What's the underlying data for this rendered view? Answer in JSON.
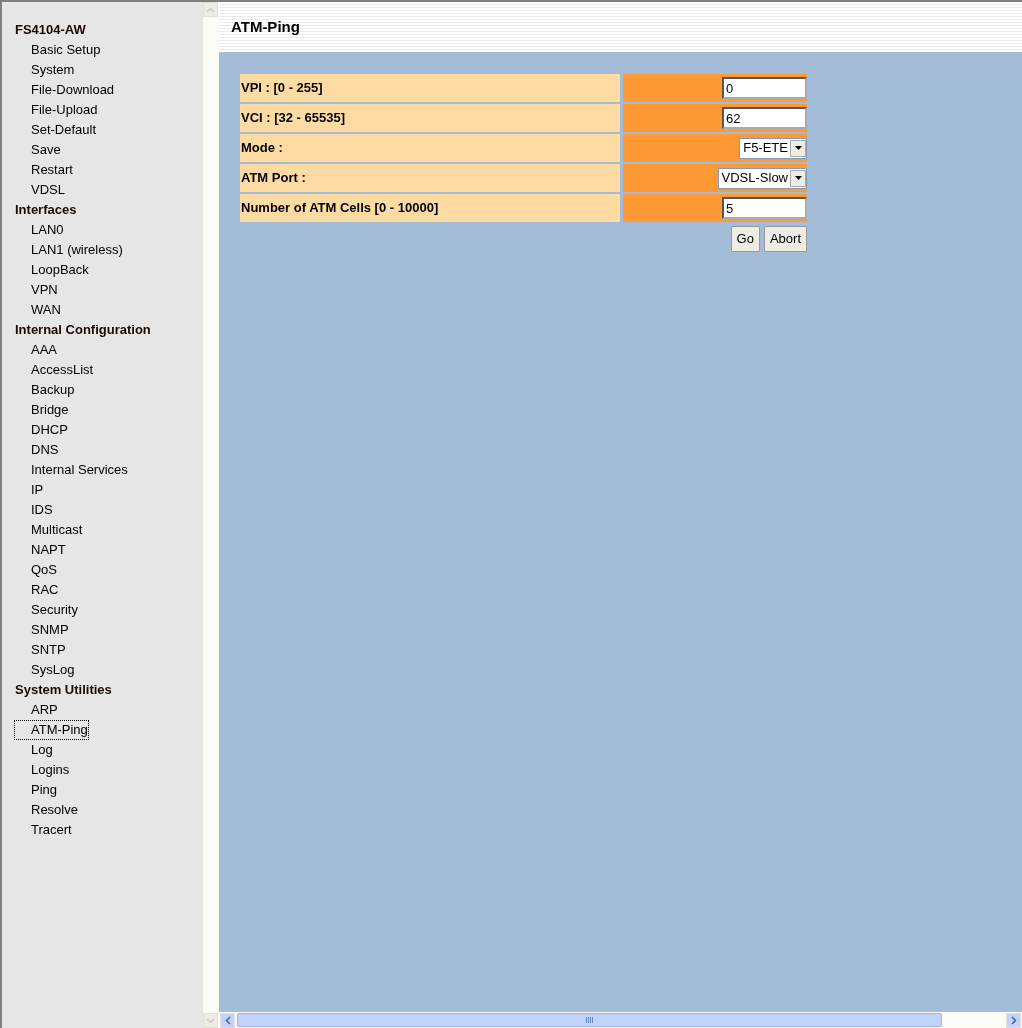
{
  "sidebar": {
    "groups": [
      {
        "title": "FS4104-AW",
        "items": [
          {
            "label": "Basic Setup",
            "selected": false
          },
          {
            "label": "System",
            "selected": false
          },
          {
            "label": "File-Download",
            "selected": false
          },
          {
            "label": "File-Upload",
            "selected": false
          },
          {
            "label": "Set-Default",
            "selected": false
          },
          {
            "label": "Save",
            "selected": false
          },
          {
            "label": "Restart",
            "selected": false
          },
          {
            "label": "VDSL",
            "selected": false
          }
        ]
      },
      {
        "title": "Interfaces",
        "items": [
          {
            "label": "LAN0",
            "selected": false
          },
          {
            "label": "LAN1 (wireless)",
            "selected": false
          },
          {
            "label": "LoopBack",
            "selected": false
          },
          {
            "label": "VPN",
            "selected": false
          },
          {
            "label": "WAN",
            "selected": false
          }
        ]
      },
      {
        "title": "Internal Configuration",
        "items": [
          {
            "label": "AAA",
            "selected": false
          },
          {
            "label": "AccessList",
            "selected": false
          },
          {
            "label": "Backup",
            "selected": false
          },
          {
            "label": "Bridge",
            "selected": false
          },
          {
            "label": "DHCP",
            "selected": false
          },
          {
            "label": "DNS",
            "selected": false
          },
          {
            "label": "Internal Services",
            "selected": false
          },
          {
            "label": "IP",
            "selected": false
          },
          {
            "label": "IDS",
            "selected": false
          },
          {
            "label": "Multicast",
            "selected": false
          },
          {
            "label": "NAPT",
            "selected": false
          },
          {
            "label": "QoS",
            "selected": false
          },
          {
            "label": "RAC",
            "selected": false
          },
          {
            "label": "Security",
            "selected": false
          },
          {
            "label": "SNMP",
            "selected": false
          },
          {
            "label": "SNTP",
            "selected": false
          },
          {
            "label": "SysLog",
            "selected": false
          }
        ]
      },
      {
        "title": "System Utilities",
        "items": [
          {
            "label": "ARP",
            "selected": false
          },
          {
            "label": "ATM-Ping",
            "selected": true
          },
          {
            "label": "Log",
            "selected": false
          },
          {
            "label": "Logins",
            "selected": false
          },
          {
            "label": "Ping",
            "selected": false
          },
          {
            "label": "Resolve",
            "selected": false
          },
          {
            "label": "Tracert",
            "selected": false
          }
        ]
      }
    ]
  },
  "page": {
    "title": "ATM-Ping"
  },
  "form": {
    "rows": [
      {
        "kind": "input",
        "label": "VPI : [0 - 255]",
        "value": "0"
      },
      {
        "kind": "input",
        "label": "VCI : [32 - 65535]",
        "value": "62"
      },
      {
        "kind": "select",
        "label": "Mode :",
        "value": "F5-ETE"
      },
      {
        "kind": "select",
        "label": "ATM Port :",
        "value": "VDSL-Slow"
      },
      {
        "kind": "input",
        "label": "Number of ATM Cells [0 - 10000]",
        "value": "5"
      }
    ],
    "buttons": [
      "Go",
      "Abort"
    ]
  }
}
